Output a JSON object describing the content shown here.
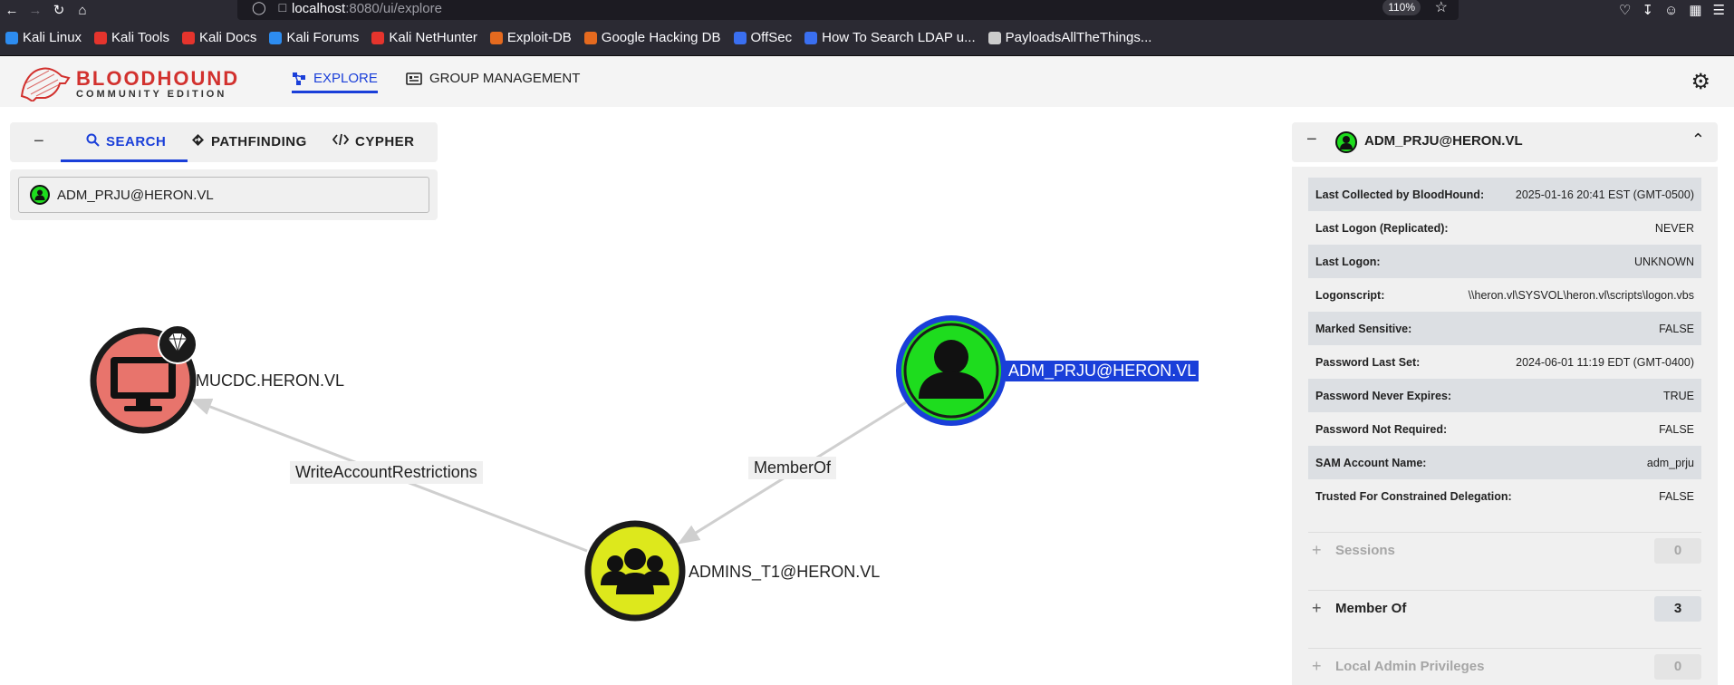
{
  "browser": {
    "url_host": "localhost",
    "url_path": ":8080/ui/explore",
    "zoom": "110%"
  },
  "bookmarks": [
    {
      "label": "Kali Linux",
      "color": "#2d8cf0"
    },
    {
      "label": "Kali Tools",
      "color": "#e5342d"
    },
    {
      "label": "Kali Docs",
      "color": "#e5342d"
    },
    {
      "label": "Kali Forums",
      "color": "#2d8cf0"
    },
    {
      "label": "Kali NetHunter",
      "color": "#e5342d"
    },
    {
      "label": "Exploit-DB",
      "color": "#e56a1f"
    },
    {
      "label": "Google Hacking DB",
      "color": "#e56a1f"
    },
    {
      "label": "OffSec",
      "color": "#3a6ff0"
    },
    {
      "label": "How To Search LDAP u...",
      "color": "#3a6ff0"
    },
    {
      "label": "PayloadsAllTheThings...",
      "color": "#cccccc"
    }
  ],
  "app": {
    "logo_title": "BLOODHOUND",
    "logo_sub": "COMMUNITY EDITION",
    "nav": {
      "explore": "EXPLORE",
      "group_management": "GROUP MANAGEMENT"
    }
  },
  "search_panel": {
    "collapse": "−",
    "tabs": {
      "search": "SEARCH",
      "pathfinding": "PATHFINDING",
      "cypher": "CYPHER"
    },
    "query": "ADM_PRJU@HERON.VL"
  },
  "graph": {
    "nodes": {
      "computer": "MUCDC.HERON.VL",
      "user": "ADM_PRJU@HERON.VL",
      "group": "ADMINS_T1@HERON.VL"
    },
    "edges": {
      "write": "WriteAccountRestrictions",
      "member": "MemberOf"
    },
    "colors": {
      "computer": "#e8746c",
      "user": "#1edc1e",
      "group": "#dde81c",
      "selected": "#1a3fd9"
    }
  },
  "entity_panel": {
    "title": "ADM_PRJU@HERON.VL",
    "properties": [
      {
        "key": "Last Collected by BloodHound:",
        "value": "2025-01-16 20:41 EST (GMT-0500)"
      },
      {
        "key": "Last Logon (Replicated):",
        "value": "NEVER"
      },
      {
        "key": "Last Logon:",
        "value": "UNKNOWN"
      },
      {
        "key": "Logonscript:",
        "value": "\\\\heron.vl\\SYSVOL\\heron.vl\\scripts\\logon.vbs"
      },
      {
        "key": "Marked Sensitive:",
        "value": "FALSE"
      },
      {
        "key": "Password Last Set:",
        "value": "2024-06-01 11:19 EDT (GMT-0400)"
      },
      {
        "key": "Password Never Expires:",
        "value": "TRUE"
      },
      {
        "key": "Password Not Required:",
        "value": "FALSE"
      },
      {
        "key": "SAM Account Name:",
        "value": "adm_prju"
      },
      {
        "key": "Trusted For Constrained Delegation:",
        "value": "FALSE"
      }
    ],
    "sections": [
      {
        "label": "Sessions",
        "count": "0"
      },
      {
        "label": "Member Of",
        "count": "3"
      },
      {
        "label": "Local Admin Privileges",
        "count": "0"
      }
    ]
  }
}
